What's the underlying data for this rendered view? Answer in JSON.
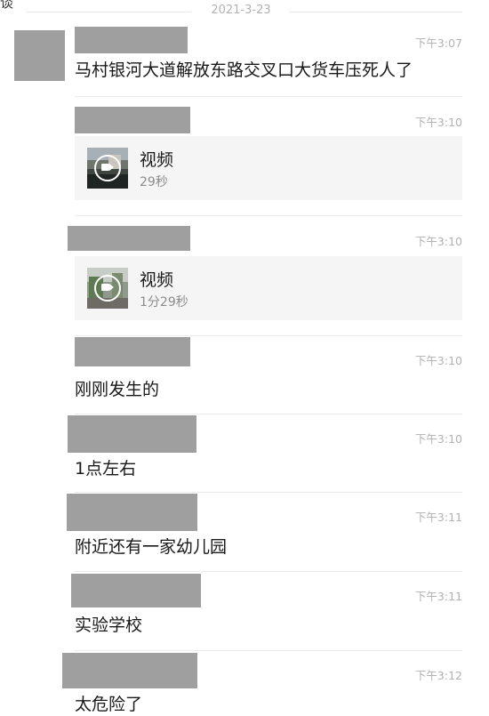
{
  "header": {
    "date": "2021-3-23",
    "corner_glyph": "谈"
  },
  "messages": [
    {
      "time": "下午3:07",
      "text": "马村银河大道解放东路交叉口大货车压死人了"
    },
    {
      "time": "下午3:10",
      "video": {
        "title": "视频",
        "duration": "29秒"
      }
    },
    {
      "time": "下午3:10",
      "video": {
        "title": "视频",
        "duration": "1分29秒"
      }
    },
    {
      "time": "下午3:10",
      "text": "刚刚发生的"
    },
    {
      "time": "下午3:10",
      "text": "1点左右"
    },
    {
      "time": "下午3:11",
      "text": "附近还有一家幼儿园"
    },
    {
      "time": "下午3:11",
      "text": "实验学校"
    },
    {
      "time": "下午3:12",
      "text": "太危险了"
    }
  ],
  "icons": {
    "video_thumb_1": "video-camera-icon",
    "video_thumb_2": "video-camera-icon"
  }
}
